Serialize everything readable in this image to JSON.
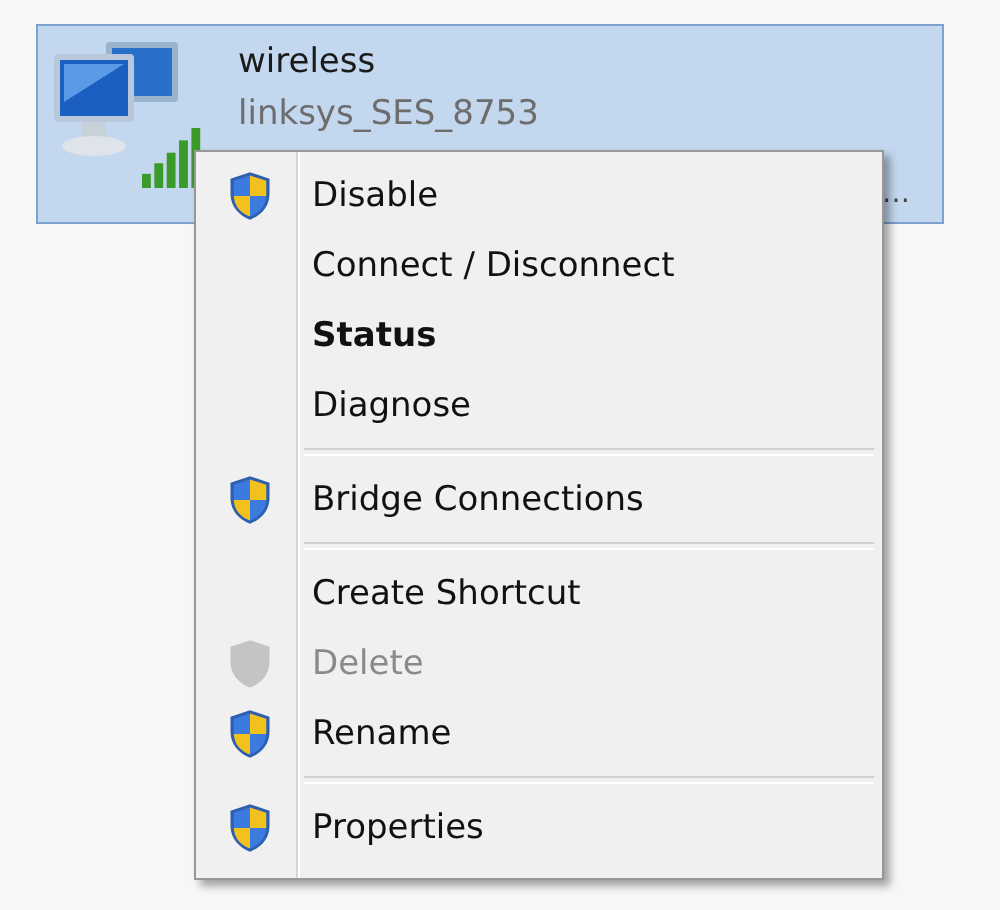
{
  "connection": {
    "name": "wireless",
    "network": "linksys_SES_8753",
    "device_tail": "…",
    "selected": true
  },
  "menu": [
    {
      "kind": "item",
      "label": "Disable",
      "shield": true,
      "bold": false,
      "disabled": false
    },
    {
      "kind": "item",
      "label": "Connect / Disconnect",
      "shield": false,
      "bold": false,
      "disabled": false
    },
    {
      "kind": "item",
      "label": "Status",
      "shield": false,
      "bold": true,
      "disabled": false
    },
    {
      "kind": "item",
      "label": "Diagnose",
      "shield": false,
      "bold": false,
      "disabled": false
    },
    {
      "kind": "separator"
    },
    {
      "kind": "item",
      "label": "Bridge Connections",
      "shield": true,
      "bold": false,
      "disabled": false
    },
    {
      "kind": "separator"
    },
    {
      "kind": "item",
      "label": "Create Shortcut",
      "shield": false,
      "bold": false,
      "disabled": false
    },
    {
      "kind": "item",
      "label": "Delete",
      "shield": true,
      "bold": false,
      "disabled": true
    },
    {
      "kind": "item",
      "label": "Rename",
      "shield": true,
      "bold": false,
      "disabled": false
    },
    {
      "kind": "separator"
    },
    {
      "kind": "item",
      "label": "Properties",
      "shield": true,
      "bold": false,
      "disabled": false
    }
  ]
}
